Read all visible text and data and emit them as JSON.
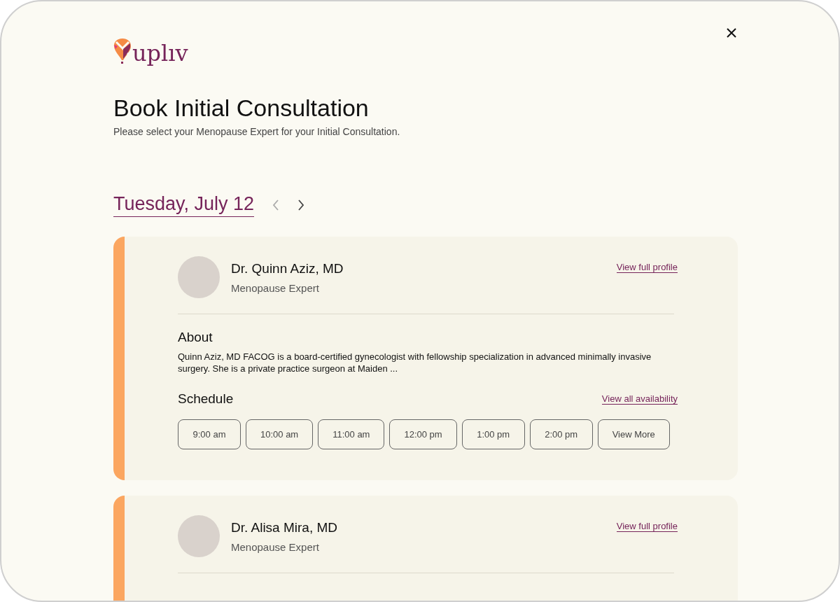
{
  "logo": {
    "text": "uplıv"
  },
  "title": "Book Initial Consultation",
  "subtitle": "Please select your Menopause Expert for your Initial Consultation.",
  "date_nav": {
    "date": "Tuesday, July 12",
    "prev_disabled": true,
    "next_disabled": false
  },
  "experts": [
    {
      "name": "Dr. Quinn Aziz, MD",
      "role": "Menopause Expert",
      "profile_link": "View full profile",
      "about_heading": "About",
      "about": "Quinn Aziz, MD FACOG is a board-certified gynecologist with fellowship specialization in advanced minimally invasive surgery. She is a private practice surgeon at Maiden ...",
      "schedule_heading": "Schedule",
      "availability_link": "View all availability",
      "slots": [
        "9:00 am",
        "10:00 am",
        "11:00 am",
        "12:00 pm",
        "1:00 pm",
        "2:00 pm",
        "View More"
      ]
    },
    {
      "name": "Dr. Alisa Mira, MD",
      "role": "Menopause Expert",
      "profile_link": "View full profile"
    }
  ]
}
